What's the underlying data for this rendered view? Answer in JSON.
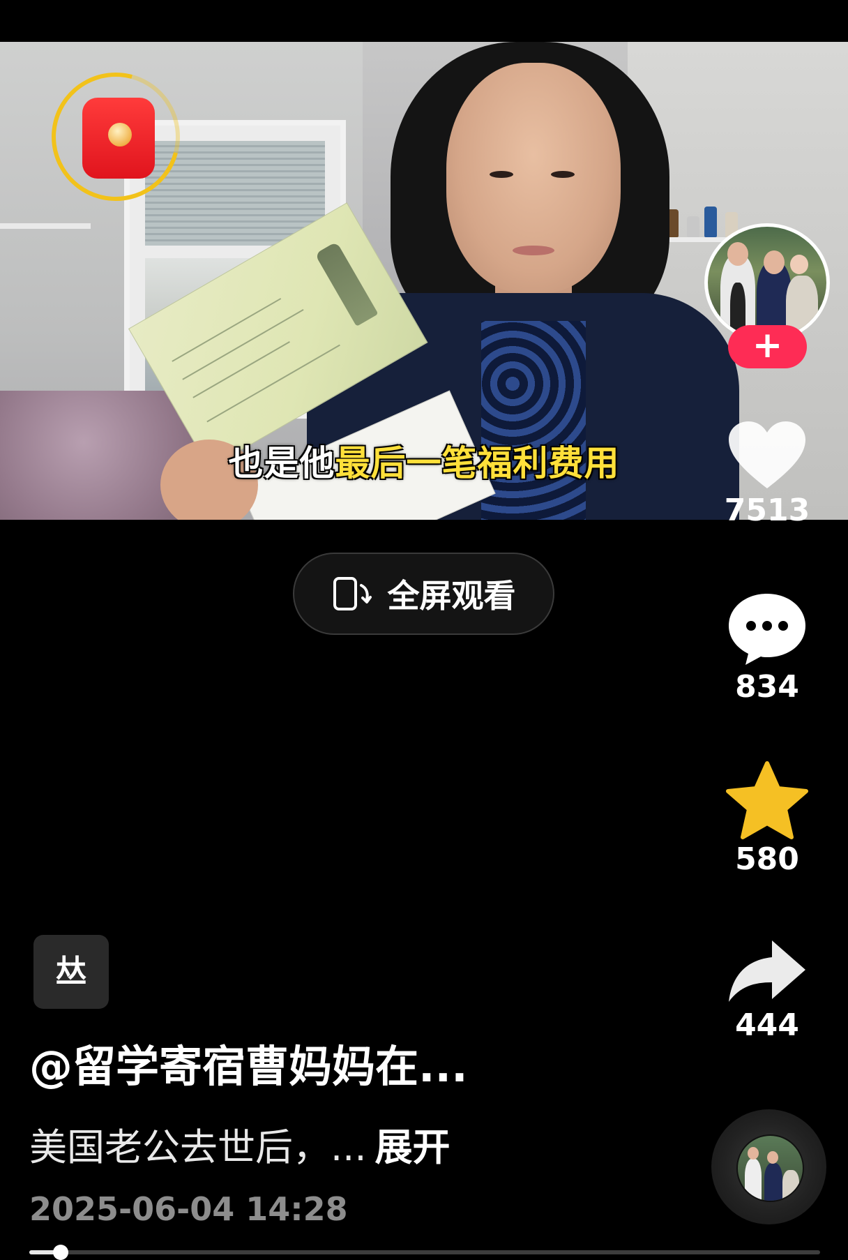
{
  "video": {
    "subtitle_white": "也是他",
    "subtitle_yellow": "最后一笔福利费用"
  },
  "red_packet": {
    "icon": "red-envelope-icon",
    "ring_color": "#f2c21a"
  },
  "author_avatar": {
    "follow_label": "+",
    "follow_color": "#fe2c55"
  },
  "actions": {
    "likes": "7513",
    "comments": "834",
    "favorites": "580",
    "shares": "444"
  },
  "fullscreen": {
    "label": "全屏观看",
    "icon": "rotate-screen-icon"
  },
  "music_button": {
    "label": "𠀤"
  },
  "post": {
    "author": "@留学寄宿曹妈妈在...",
    "description": "美国老公去世后，...",
    "expand": "展开",
    "date": "2025-06-04 14:28"
  },
  "progress": {
    "fraction": 0.04
  },
  "colors": {
    "star": "#f5c024",
    "background": "#000000"
  }
}
